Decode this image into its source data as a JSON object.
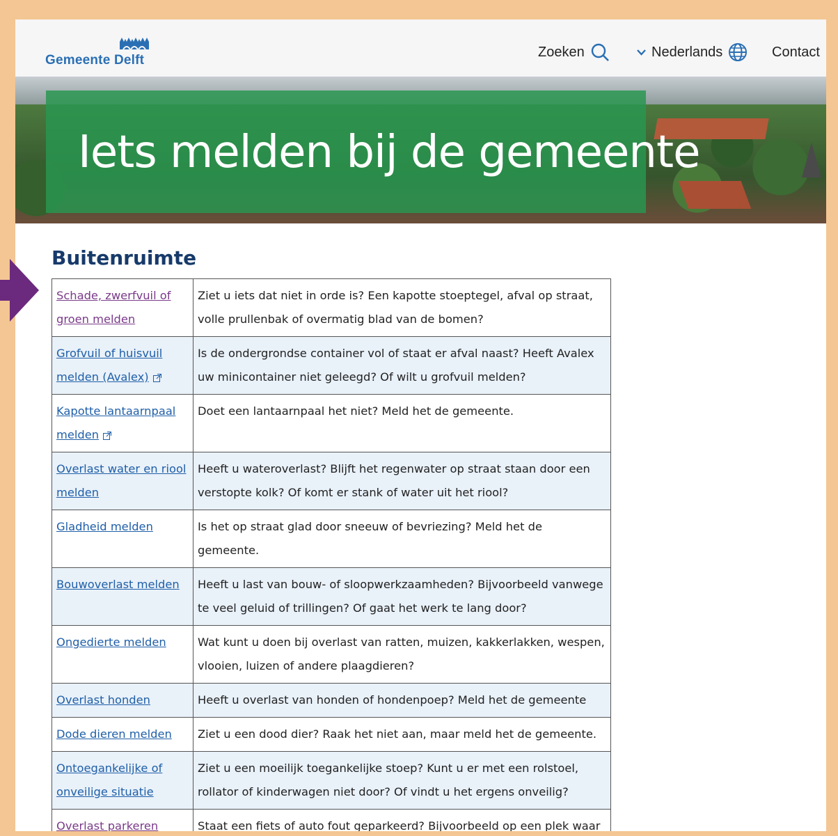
{
  "header": {
    "logo_text": "Gemeente Delft",
    "search_label": "Zoeken",
    "language_label": "Nederlands",
    "contact_label": "Contact"
  },
  "hero": {
    "title": "Iets melden bij de gemeente"
  },
  "section": {
    "title": "Buitenruimte"
  },
  "colors": {
    "link": "#1f5fa8",
    "visited_link": "#7a3a8a",
    "hero_panel": "#28965a",
    "title": "#173a6a",
    "alt_row": "#e9f1f9",
    "arrow": "#6b2a7e"
  },
  "rows": [
    {
      "link": "Schade, zwerfvuil of groen melden",
      "desc": "Ziet u iets dat niet in orde is? Een kapotte stoeptegel, afval op straat, volle prullenbak of overmatig blad van de bomen?"
    },
    {
      "link": "Grofvuil of huisvuil melden (Avalex)",
      "desc": "Is de ondergrondse container vol of staat er afval naast? Heeft Avalex uw minicontainer niet geleegd? Of wilt u grofvuil melden?"
    },
    {
      "link": "Kapotte lantaarnpaal melden",
      "desc": "Doet een lantaarnpaal het niet? Meld het de gemeente."
    },
    {
      "link": "Overlast water en riool melden",
      "desc": "Heeft u wateroverlast? Blijft het regenwater op straat staan door een verstopte kolk? Of komt er stank of water uit het riool?"
    },
    {
      "link": "Gladheid melden",
      "desc": "Is het op straat glad door sneeuw of bevriezing? Meld het de gemeente."
    },
    {
      "link": "Bouwoverlast melden",
      "desc": "Heeft u last van bouw- of sloopwerkzaamheden? Bijvoorbeeld vanwege te veel geluid of trillingen? Of gaat het werk te lang door?"
    },
    {
      "link": "Ongedierte melden",
      "desc": "Wat kunt u doen bij overlast van ratten, muizen, kakkerlakken, wespen, vlooien, luizen of andere plaagdieren?"
    },
    {
      "link": "Overlast honden",
      "desc": "Heeft u overlast van honden of hondenpoep? Meld het de gemeente"
    },
    {
      "link": "Dode dieren melden",
      "desc": "Ziet u een dood dier? Raak het niet aan, maar meld het de gemeente."
    },
    {
      "link": "Ontoegankelijke of onveilige situatie",
      "desc": "Ziet u een moeilijk toegankelijke stoep? Kunt u er met een rolstoel, rollator of kinderwagen niet door? Of vindt u het ergens onveilig?"
    },
    {
      "link": "Overlast parkeren melden",
      "desc": "Staat een fiets of auto fout geparkeerd? Bijvoorbeeld op een plek waar dat niet mag? Of waar het voertuig hinder of gevaar oplevert?"
    }
  ]
}
